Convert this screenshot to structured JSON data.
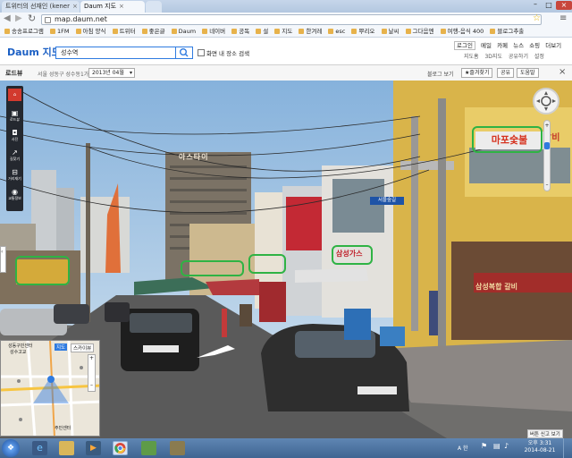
{
  "browser": {
    "tabs": [
      {
        "label": "트위터의 선재인 (kener",
        "active": false
      },
      {
        "label": "Daum 지도",
        "active": true
      },
      {
        "label": "",
        "active": false
      }
    ],
    "url": "map.daum.net",
    "bookmarks": [
      "송송프로그램",
      "1FM",
      "아침 양식",
      "트위터",
      "좋은글",
      "Daum",
      "네이버",
      "공독",
      "설",
      "지도",
      "한겨레",
      "esc",
      "뿌리오",
      "날씨",
      "그다음엔",
      "여행-음식 400",
      "블로그추출"
    ]
  },
  "daum": {
    "logo": "Daum 지도",
    "search_value": "성수역",
    "map_checkbox_label": "화면 내 장소 검색",
    "top_links": [
      "로그인",
      "메일",
      "카페",
      "뉴스",
      "쇼핑",
      "더보기"
    ],
    "sub_links": [
      "지도홈",
      "3D지도",
      "공유하기",
      "설정"
    ]
  },
  "roadview": {
    "title": "로드뷰",
    "address": "서울 성동구 성수동1가",
    "date_select": "2013년 04월",
    "right_actions": [
      "블로그 보기",
      "즐겨찾기",
      "공유",
      "도움말"
    ],
    "left_tools": [
      "로드뷰",
      "사진",
      "길찾기",
      "거리재기",
      "교통정보",
      "자전거"
    ],
    "minimap_tabs": [
      "지도",
      "스카이뷰"
    ],
    "minimap_labels": [
      "성동구민센터",
      "성수고교",
      "주민센터"
    ],
    "report_button": "버튼 신고 보기",
    "signs": {
      "tower": "아스타이",
      "right_store": "마포숯불",
      "shop_center": "삼성가스",
      "right_banner": "삼성복합 갈비",
      "pole_sign": "서울숲길"
    }
  },
  "taskbar": {
    "lang": "A 한",
    "time": "오후 3:31",
    "date": "2014-08-21"
  },
  "colors": {
    "highlight": "#2fb344",
    "daum_blue": "#1b5fc4"
  }
}
